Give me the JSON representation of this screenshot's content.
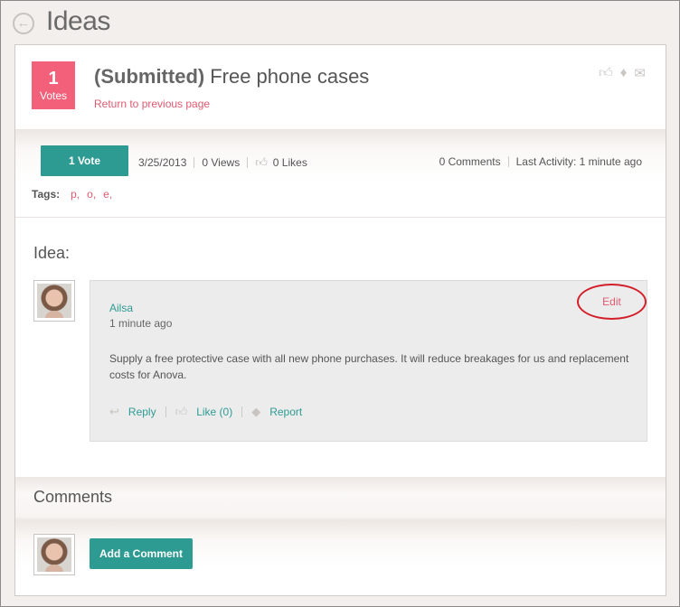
{
  "header": {
    "title": "Ideas",
    "back_icon": "arrow-left-circle-icon"
  },
  "idea": {
    "vote_count": "1",
    "vote_label": "Votes",
    "status": "(Submitted)",
    "title": "Free phone cases",
    "return_link": "Return to previous page",
    "top_icons": [
      "thumbs-up-icon",
      "tag-icon",
      "envelope-icon"
    ]
  },
  "meta": {
    "vote_button": "1 Vote",
    "date": "3/25/2013",
    "views": "0 Views",
    "likes": "0 Likes",
    "comments": "0 Comments",
    "last_activity": "Last Activity: 1 minute ago",
    "tags_label": "Tags:",
    "tags": [
      "p,",
      "o,",
      "e,"
    ]
  },
  "post": {
    "heading": "Idea:",
    "author": "Ailsa",
    "time": "1 minute ago",
    "body": "Supply a free protective case with all new phone purchases. It will reduce breakages for us and replacement costs for Anova.",
    "edit": "Edit",
    "reply": "Reply",
    "like": "Like (0)",
    "report": "Report"
  },
  "comments": {
    "heading": "Comments",
    "add_button": "Add a Comment"
  },
  "colors": {
    "accent": "#2e9b93",
    "vote_box": "#f2607a",
    "link": "#e05a70",
    "highlight_ring": "#d31f2a"
  }
}
